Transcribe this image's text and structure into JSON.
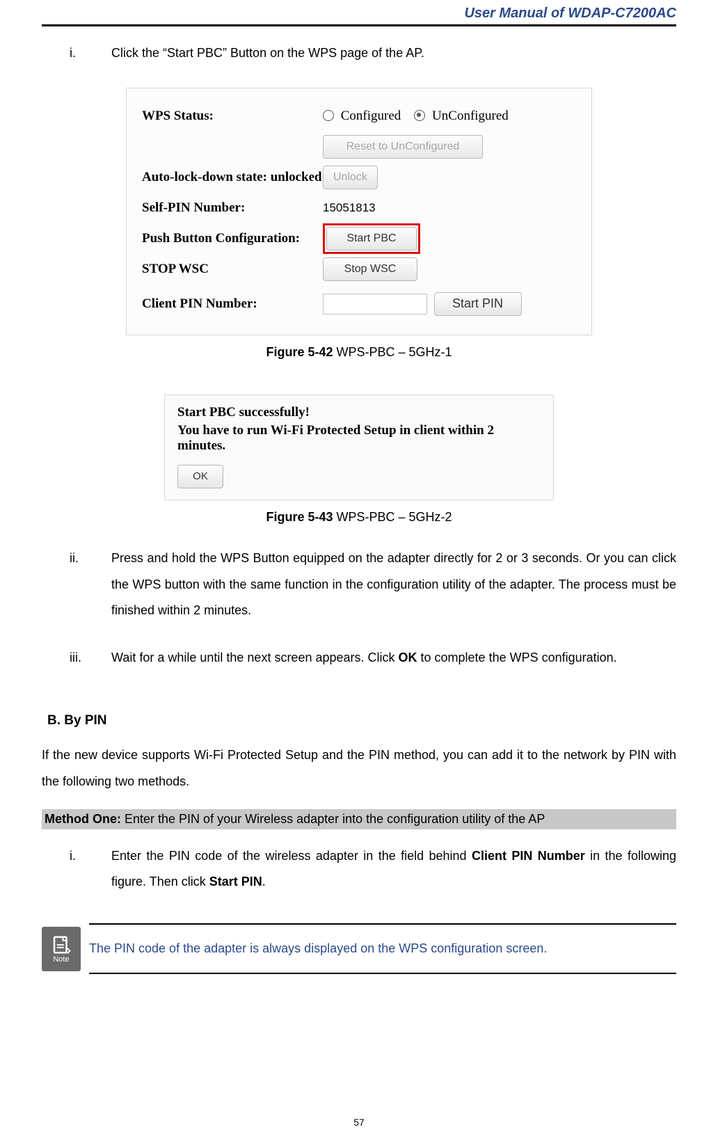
{
  "header": {
    "title": "User Manual of WDAP-C7200AC"
  },
  "steps_top": {
    "i": {
      "marker": "i.",
      "text": "Click the “Start PBC” Button on the WPS page of the AP."
    }
  },
  "panel1": {
    "wps_status_label": "WPS Status:",
    "configured_label": "Configured",
    "unconfigured_label": "UnConfigured",
    "reset_btn": "Reset to UnConfigured",
    "autolock_label": "Auto-lock-down state: unlocked",
    "unlock_btn": "Unlock",
    "selfpin_label": "Self-PIN Number:",
    "selfpin_value": "15051813",
    "pbc_label": "Push Button Configuration:",
    "start_pbc_btn": "Start PBC",
    "stop_wsc_label": "STOP WSC",
    "stop_wsc_btn": "Stop WSC",
    "client_pin_label": "Client PIN Number:",
    "start_pin_btn": "Start PIN"
  },
  "fig1": {
    "bold": "Figure 5-42",
    "rest": " WPS-PBC – 5GHz-1"
  },
  "panel2": {
    "line1": "Start PBC successfully!",
    "line2": "You have to run Wi-Fi Protected Setup in client within 2 minutes.",
    "ok": "OK"
  },
  "fig2": {
    "bold": "Figure 5-43",
    "rest": " WPS-PBC – 5GHz-2"
  },
  "steps_mid": {
    "ii": {
      "marker": "ii.",
      "text": "Press and hold the WPS Button equipped on the adapter directly for 2 or 3 seconds. Or you can click the WPS button with the same function in the configuration utility of the adapter. The process must be finished within 2 minutes."
    },
    "iii": {
      "marker": "iii.",
      "pre": "Wait for a while until the next screen appears. Click ",
      "bold": "OK",
      "post": " to complete the WPS configuration."
    }
  },
  "section_b": {
    "label": "B.    By PIN"
  },
  "para_b": "If the new device supports Wi-Fi Protected Setup and the PIN method, you can add it to the network by PIN with the following two methods.",
  "method1": {
    "bold": "Method One:",
    "rest": " Enter the PIN of your Wireless adapter into the configuration utility of the AP"
  },
  "step_b_i": {
    "marker": "i.",
    "pre": "Enter the PIN code of the wireless adapter in the field behind ",
    "b1": "Client PIN Number",
    "mid": " in the following figure. Then click ",
    "b2": "Start PIN",
    "post": "."
  },
  "note": {
    "icon_label": "Note",
    "text": "The PIN code of the adapter is always displayed on the WPS configuration screen."
  },
  "footer": {
    "page": "57"
  }
}
